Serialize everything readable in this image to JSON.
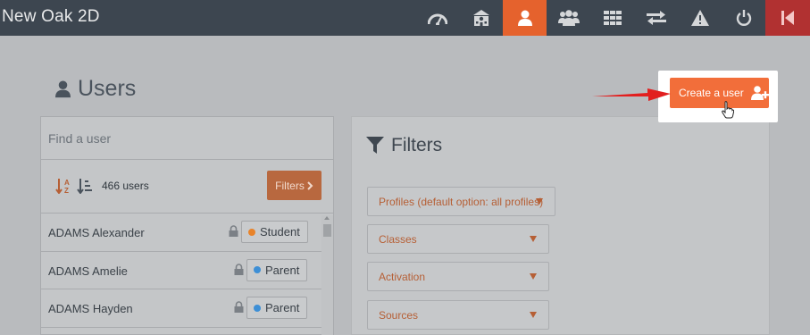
{
  "app": {
    "title": "New Oak 2D"
  },
  "nav": {
    "items": [
      {
        "icon": "dashboard-gauge-icon"
      },
      {
        "icon": "school-building-icon"
      },
      {
        "icon": "user-icon",
        "active": true
      },
      {
        "icon": "users-group-icon"
      },
      {
        "icon": "grid-icon"
      },
      {
        "icon": "transfer-arrows-icon"
      },
      {
        "icon": "warning-icon"
      },
      {
        "icon": "power-icon"
      },
      {
        "icon": "exit-icon"
      }
    ],
    "colors": {
      "bar": "#3d4650",
      "active": "#e5622d",
      "exit": "#b13131"
    }
  },
  "page": {
    "title": "Users"
  },
  "search": {
    "placeholder": "Find a user"
  },
  "user_list": {
    "count_label": "466 users",
    "filters_button": "Filters",
    "users": [
      {
        "name": "ADAMS Alexander",
        "role": "Student",
        "role_color": "#e8832a"
      },
      {
        "name": "ADAMS Amelie",
        "role": "Parent",
        "role_color": "#3d8fd6"
      },
      {
        "name": "ADAMS Hayden",
        "role": "Parent",
        "role_color": "#3d8fd6"
      }
    ]
  },
  "filters_panel": {
    "title": "Filters",
    "dropdowns": [
      {
        "label": "Profiles (default option: all profiles)"
      },
      {
        "label": "Classes"
      },
      {
        "label": "Activation"
      },
      {
        "label": "Sources"
      }
    ]
  },
  "create_user": {
    "label": "Create a user",
    "color": "#f26e3a"
  },
  "annotation": {
    "arrow_color": "#e21f1f"
  }
}
